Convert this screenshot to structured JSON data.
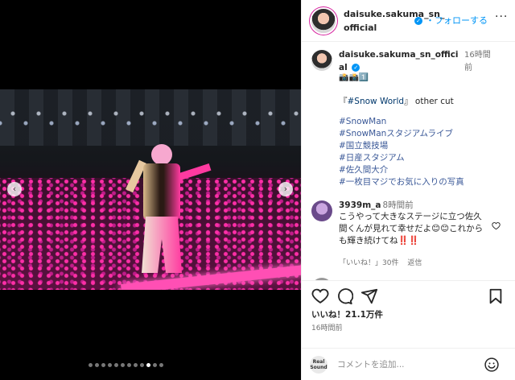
{
  "post": {
    "header": {
      "username": "daisuke.sakuma_sn_official",
      "verified_mark": "✓",
      "follow_label": "・フォローする",
      "more_label": "···"
    },
    "media": {
      "prev_label": "‹",
      "next_label": "›",
      "dot_count": 12,
      "active_dot_index": 9
    },
    "caption": {
      "username": "daisuke.sakuma_sn_official",
      "time": "16時間前",
      "emoji": "📸📸1️⃣",
      "title_prefix": "『",
      "title_tag": "#Snow World",
      "title_suffix": "』 other cut",
      "hashtags": [
        "#SnowMan",
        "#SnowManスタジアムライブ",
        "#国立競技場",
        "#日産スタジアム",
        "#佐久間大介",
        "#一枚目マジでお気に入りの写真"
      ]
    },
    "comment": {
      "username": "3939m_a",
      "time": "8時間前",
      "text": "こうやって大きなステージに立つ佐久間くんが見れて幸せだよ😊😊これからも輝き続けてね‼️‼️",
      "likes_label": "「いいね！」30件",
      "reply_label": "返信"
    },
    "actions": {
      "likes": "いいね！21.1万件",
      "posted": "16時間前"
    },
    "add_comment": {
      "logo_text": "Real Sound",
      "placeholder": "コメントを追加..."
    }
  },
  "icons": {
    "like": "heart-icon",
    "comment": "comment-bubble-icon",
    "share": "paper-plane-icon",
    "save": "bookmark-icon",
    "emoji": "smiley-icon"
  }
}
